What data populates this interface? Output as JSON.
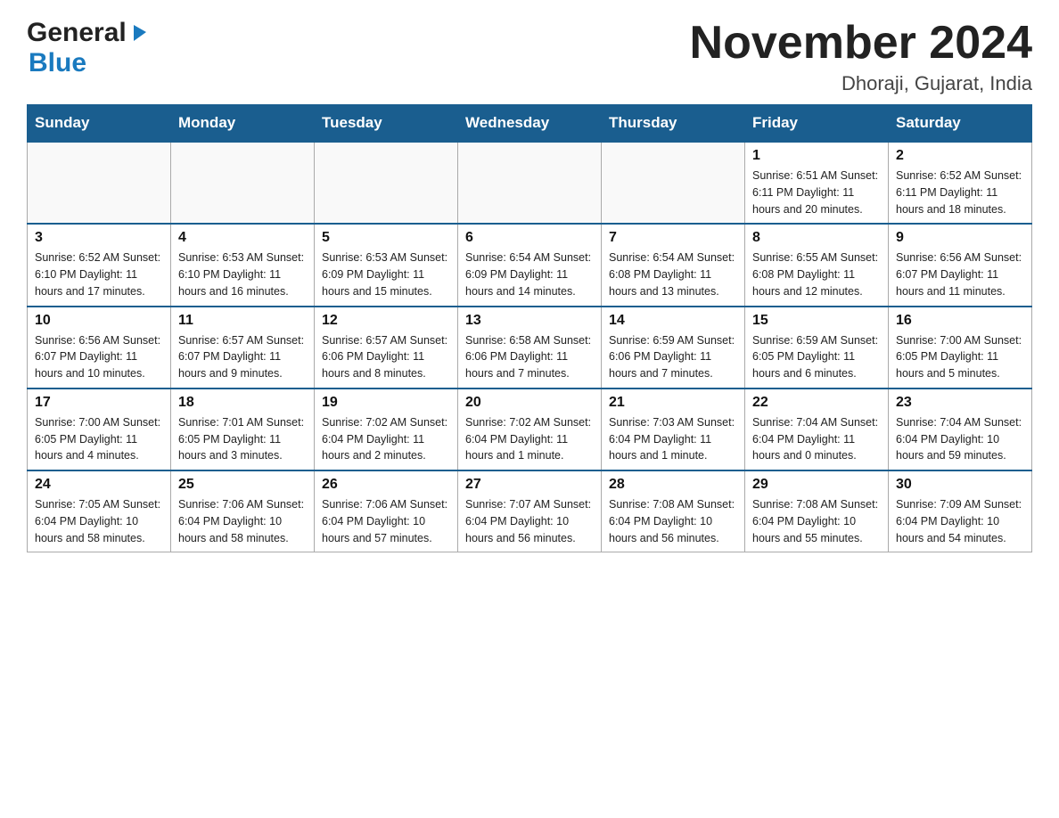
{
  "header": {
    "logo_general": "General",
    "logo_blue": "Blue",
    "month_title": "November 2024",
    "location": "Dhoraji, Gujarat, India"
  },
  "days_of_week": [
    "Sunday",
    "Monday",
    "Tuesday",
    "Wednesday",
    "Thursday",
    "Friday",
    "Saturday"
  ],
  "weeks": [
    {
      "days": [
        {
          "num": "",
          "info": ""
        },
        {
          "num": "",
          "info": ""
        },
        {
          "num": "",
          "info": ""
        },
        {
          "num": "",
          "info": ""
        },
        {
          "num": "",
          "info": ""
        },
        {
          "num": "1",
          "info": "Sunrise: 6:51 AM\nSunset: 6:11 PM\nDaylight: 11 hours\nand 20 minutes."
        },
        {
          "num": "2",
          "info": "Sunrise: 6:52 AM\nSunset: 6:11 PM\nDaylight: 11 hours\nand 18 minutes."
        }
      ]
    },
    {
      "days": [
        {
          "num": "3",
          "info": "Sunrise: 6:52 AM\nSunset: 6:10 PM\nDaylight: 11 hours\nand 17 minutes."
        },
        {
          "num": "4",
          "info": "Sunrise: 6:53 AM\nSunset: 6:10 PM\nDaylight: 11 hours\nand 16 minutes."
        },
        {
          "num": "5",
          "info": "Sunrise: 6:53 AM\nSunset: 6:09 PM\nDaylight: 11 hours\nand 15 minutes."
        },
        {
          "num": "6",
          "info": "Sunrise: 6:54 AM\nSunset: 6:09 PM\nDaylight: 11 hours\nand 14 minutes."
        },
        {
          "num": "7",
          "info": "Sunrise: 6:54 AM\nSunset: 6:08 PM\nDaylight: 11 hours\nand 13 minutes."
        },
        {
          "num": "8",
          "info": "Sunrise: 6:55 AM\nSunset: 6:08 PM\nDaylight: 11 hours\nand 12 minutes."
        },
        {
          "num": "9",
          "info": "Sunrise: 6:56 AM\nSunset: 6:07 PM\nDaylight: 11 hours\nand 11 minutes."
        }
      ]
    },
    {
      "days": [
        {
          "num": "10",
          "info": "Sunrise: 6:56 AM\nSunset: 6:07 PM\nDaylight: 11 hours\nand 10 minutes."
        },
        {
          "num": "11",
          "info": "Sunrise: 6:57 AM\nSunset: 6:07 PM\nDaylight: 11 hours\nand 9 minutes."
        },
        {
          "num": "12",
          "info": "Sunrise: 6:57 AM\nSunset: 6:06 PM\nDaylight: 11 hours\nand 8 minutes."
        },
        {
          "num": "13",
          "info": "Sunrise: 6:58 AM\nSunset: 6:06 PM\nDaylight: 11 hours\nand 7 minutes."
        },
        {
          "num": "14",
          "info": "Sunrise: 6:59 AM\nSunset: 6:06 PM\nDaylight: 11 hours\nand 7 minutes."
        },
        {
          "num": "15",
          "info": "Sunrise: 6:59 AM\nSunset: 6:05 PM\nDaylight: 11 hours\nand 6 minutes."
        },
        {
          "num": "16",
          "info": "Sunrise: 7:00 AM\nSunset: 6:05 PM\nDaylight: 11 hours\nand 5 minutes."
        }
      ]
    },
    {
      "days": [
        {
          "num": "17",
          "info": "Sunrise: 7:00 AM\nSunset: 6:05 PM\nDaylight: 11 hours\nand 4 minutes."
        },
        {
          "num": "18",
          "info": "Sunrise: 7:01 AM\nSunset: 6:05 PM\nDaylight: 11 hours\nand 3 minutes."
        },
        {
          "num": "19",
          "info": "Sunrise: 7:02 AM\nSunset: 6:04 PM\nDaylight: 11 hours\nand 2 minutes."
        },
        {
          "num": "20",
          "info": "Sunrise: 7:02 AM\nSunset: 6:04 PM\nDaylight: 11 hours\nand 1 minute."
        },
        {
          "num": "21",
          "info": "Sunrise: 7:03 AM\nSunset: 6:04 PM\nDaylight: 11 hours\nand 1 minute."
        },
        {
          "num": "22",
          "info": "Sunrise: 7:04 AM\nSunset: 6:04 PM\nDaylight: 11 hours\nand 0 minutes."
        },
        {
          "num": "23",
          "info": "Sunrise: 7:04 AM\nSunset: 6:04 PM\nDaylight: 10 hours\nand 59 minutes."
        }
      ]
    },
    {
      "days": [
        {
          "num": "24",
          "info": "Sunrise: 7:05 AM\nSunset: 6:04 PM\nDaylight: 10 hours\nand 58 minutes."
        },
        {
          "num": "25",
          "info": "Sunrise: 7:06 AM\nSunset: 6:04 PM\nDaylight: 10 hours\nand 58 minutes."
        },
        {
          "num": "26",
          "info": "Sunrise: 7:06 AM\nSunset: 6:04 PM\nDaylight: 10 hours\nand 57 minutes."
        },
        {
          "num": "27",
          "info": "Sunrise: 7:07 AM\nSunset: 6:04 PM\nDaylight: 10 hours\nand 56 minutes."
        },
        {
          "num": "28",
          "info": "Sunrise: 7:08 AM\nSunset: 6:04 PM\nDaylight: 10 hours\nand 56 minutes."
        },
        {
          "num": "29",
          "info": "Sunrise: 7:08 AM\nSunset: 6:04 PM\nDaylight: 10 hours\nand 55 minutes."
        },
        {
          "num": "30",
          "info": "Sunrise: 7:09 AM\nSunset: 6:04 PM\nDaylight: 10 hours\nand 54 minutes."
        }
      ]
    }
  ],
  "colors": {
    "header_bg": "#1a5e8f",
    "header_text": "#ffffff",
    "logo_blue": "#1a7abf"
  }
}
